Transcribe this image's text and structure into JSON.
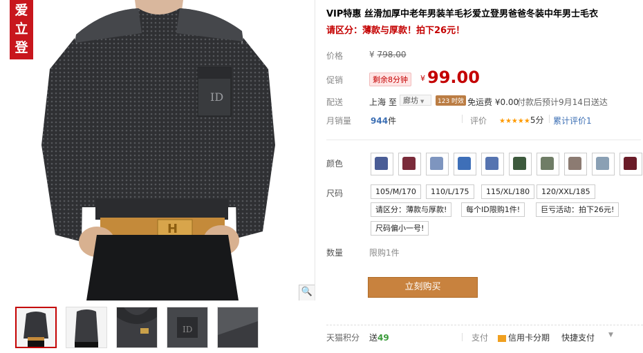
{
  "brand_tag": "爱立登",
  "title": "VIP特惠 丝滑加厚中老年男装羊毛衫爱立登男爸爸冬装中年男士毛衣",
  "subtitle": "请区分：薄款与厚款！拍下26元！",
  "price_section": {
    "original_label": "价格",
    "original_currency": "¥",
    "original_price": "798.00",
    "promo_label": "促销",
    "countdown": "剩余8分钟",
    "promo_currency": "¥",
    "promo_price": "99.00"
  },
  "shipping": {
    "label": "配送",
    "from": "上海",
    "to_word": "至",
    "destination": "廊坊",
    "badge": "123 时效",
    "fee": "免运费 ¥0.00",
    "eta": "付款后预计9月14日送达"
  },
  "sales": {
    "label": "月销量",
    "count": "944",
    "unit": "件",
    "review_label": "评价",
    "stars": "★★★★★",
    "score": "5分",
    "review_link": "累计评价1"
  },
  "color": {
    "label": "颜色",
    "swatches": [
      "#4a5d96",
      "#7a2b3a",
      "#7e95bf",
      "#3e6fb8",
      "#5674b0",
      "#3d5a3d",
      "#6f7d66",
      "#8c7b72",
      "#8aa0b4",
      "#6a1c28"
    ]
  },
  "size": {
    "label": "尺码",
    "options": [
      "105/M/170",
      "110/L/175",
      "115/XL/180",
      "120/XXL/185"
    ],
    "notes": [
      "请区分：薄款与厚款!",
      "每个ID限购1件!",
      "巨亏活动：拍下26元!",
      "尺码偏小一号!"
    ]
  },
  "quantity": {
    "label": "数量",
    "limit": "限购1件"
  },
  "buy_button": "立刻购买",
  "footer": {
    "points_label": "天猫积分",
    "points_prefix": "送",
    "points_value": "49",
    "pay_label": "支付",
    "credit_card": "信用卡分期",
    "quick_pay": "快捷支付"
  }
}
